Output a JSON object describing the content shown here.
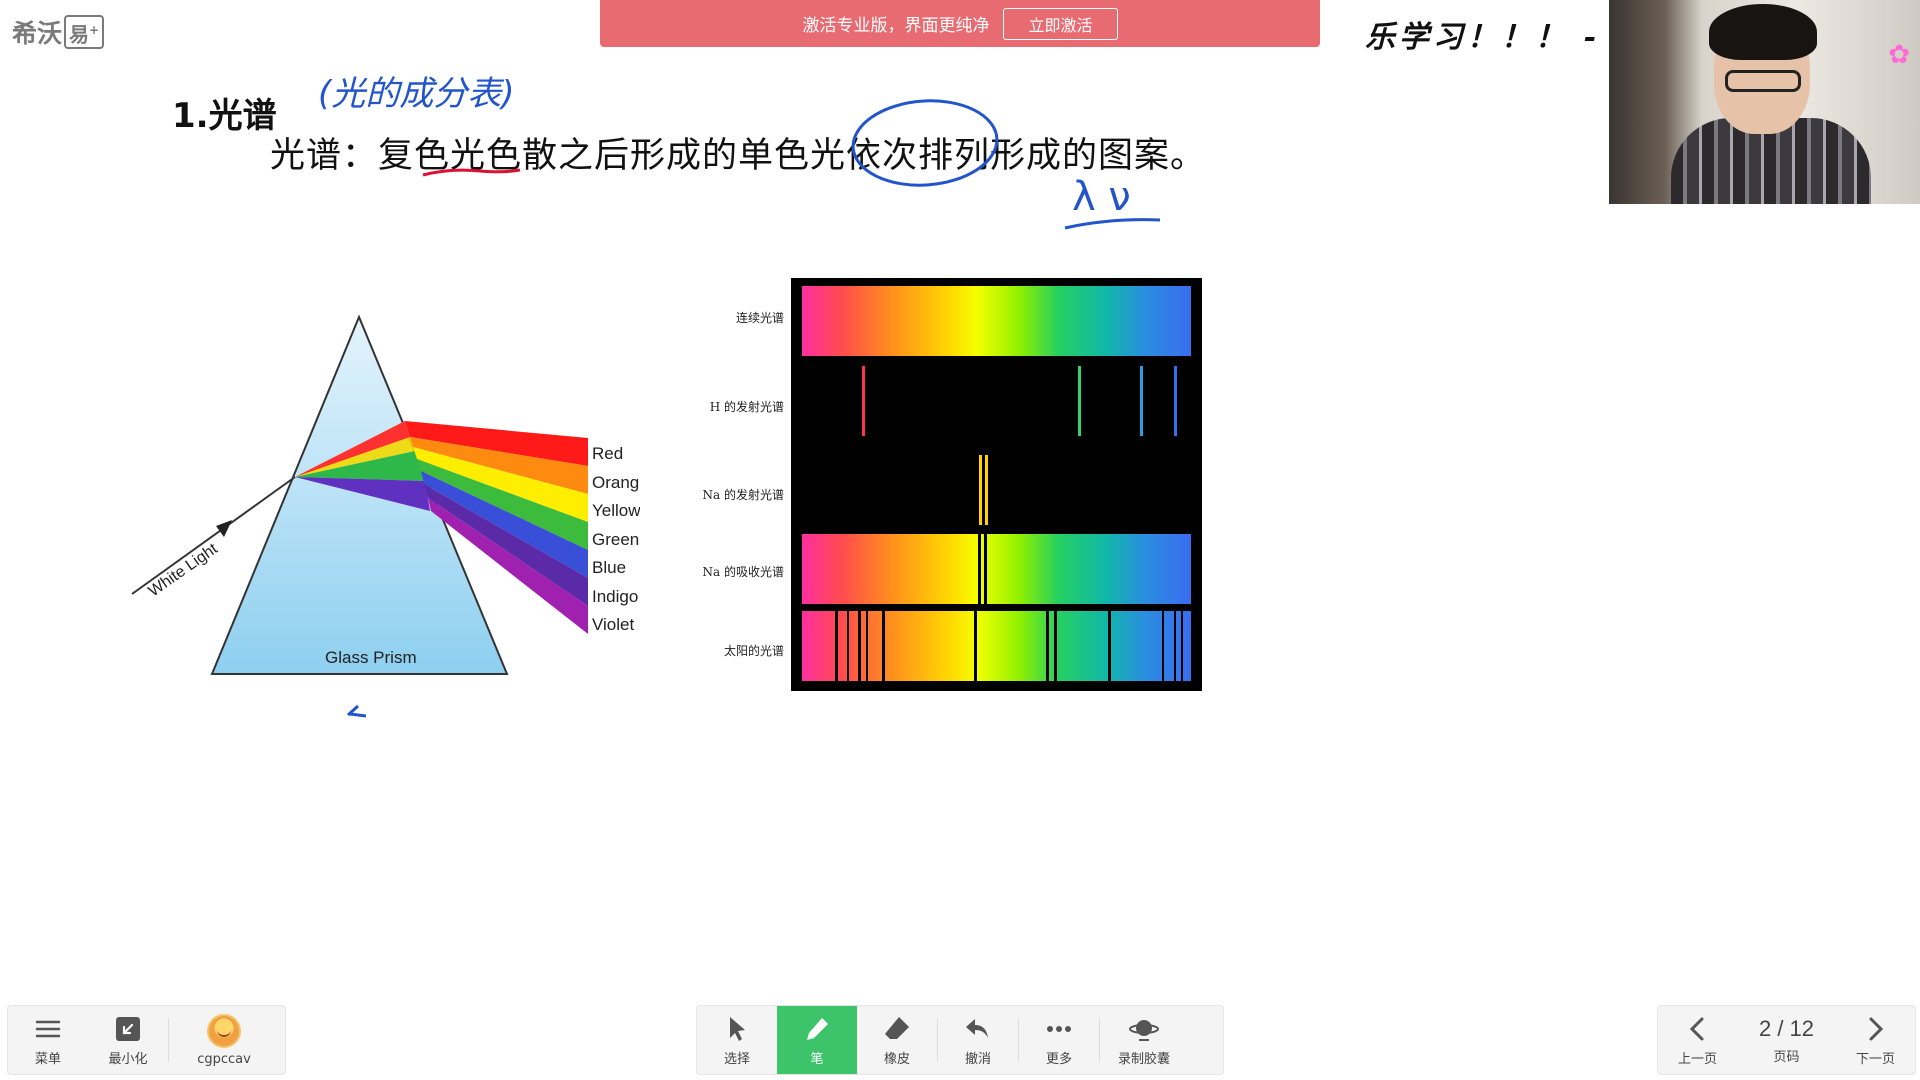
{
  "app": {
    "logo_text": "希沃",
    "logo_box": "易",
    "logo_plus": "+"
  },
  "banner": {
    "text": "激活专业版，界面更纯净",
    "button_label": "立即激活",
    "color": "#e86b72"
  },
  "scribble_top": "乐学习！！！ -",
  "slide": {
    "title": "1.光谱",
    "definition": "光谱：复色光色散之后形成的单色光依次排列形成的图案。",
    "handwritten_note": "(光的成分表)",
    "handwritten_symbols": "λ ν"
  },
  "prism_figure": {
    "colors": [
      "Red",
      "Orange",
      "Yellow",
      "Green",
      "Blue",
      "Indigo",
      "Violet"
    ],
    "input_label": "White Light",
    "prism_label": "Glass Prism"
  },
  "spectra_figure": {
    "rows": [
      {
        "label": "连续光谱"
      },
      {
        "label": "H 的发射光谱"
      },
      {
        "label": "Na 的发射光谱"
      },
      {
        "label": "Na 的吸收光谱"
      },
      {
        "label": "太阳的光谱"
      }
    ]
  },
  "toolbar_left": {
    "menu": "菜单",
    "minimize": "最小化",
    "user": "cgpccav"
  },
  "toolbar_center": {
    "select": "选择",
    "pen": "笔",
    "eraser": "橡皮",
    "undo": "撤消",
    "more": "更多",
    "record": "录制胶囊",
    "active_color": "#3dc46a"
  },
  "pager": {
    "prev": "上一页",
    "page": "2 / 12",
    "page_label": "页码",
    "next": "下一页"
  }
}
